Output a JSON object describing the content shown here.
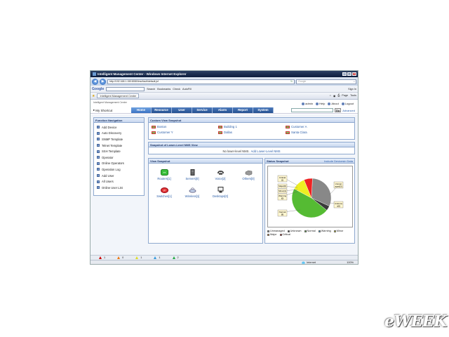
{
  "window": {
    "title": "Intelligent Management Center - Windows Internet Explorer"
  },
  "address": {
    "url": "http://192.168.1.150:8080/imc/fault/default.jsf",
    "search_placeholder": "Google"
  },
  "google_toolbar": {
    "logo": "Google",
    "search_label": "Search",
    "bookmarks": "Bookmarks",
    "check": "Check",
    "autofill": "AutoFill",
    "signin": "Sign In"
  },
  "favbar": {
    "tab_label": "Intelligent Management Center",
    "page": "Page",
    "tools": "Tools"
  },
  "imc": {
    "logo": "Intelligent Management Center",
    "shortcut": "My Shortcut",
    "user_links": {
      "admin": "admin",
      "help": "Help",
      "about": "About",
      "logout": "Logout"
    },
    "go": "Go",
    "advanced": "Advanced",
    "menu": [
      "Home",
      "Resource",
      "User",
      "Service",
      "Alarm",
      "Report",
      "System"
    ]
  },
  "function_nav": {
    "title": "Function Navigation",
    "items": [
      "Add Device",
      "Auto Discovery",
      "SNMP Template",
      "Telnet Template",
      "SSH Template",
      "Operator",
      "Online Operators",
      "Operation Log",
      "Add User",
      "All Users",
      "Online User List"
    ]
  },
  "custom_view": {
    "title": "Custom View Snapshot",
    "items": [
      "Boston",
      "Building 1",
      "Customer A",
      "Customer Y",
      "Dallas",
      "Santa Clara"
    ]
  },
  "lower_nms": {
    "title": "Snapshot of Lower-Level NMS View",
    "message": "No lower-level NMS.",
    "link": "Add Lower-Level NMS"
  },
  "view_snapshot": {
    "title": "View Snapshot",
    "items": [
      {
        "label": "Routers[1]",
        "icon": "router-icon"
      },
      {
        "label": "Servers[0]",
        "icon": "server-icon"
      },
      {
        "label": "Voice[2]",
        "icon": "voice-icon"
      },
      {
        "label": "Others[0]",
        "icon": "others-icon"
      },
      {
        "label": "Switches[1]",
        "icon": "switch-icon"
      },
      {
        "label": "Wireless[1]",
        "icon": "wireless-icon"
      },
      {
        "label": "Desktops[0]",
        "icon": "desktop-icon"
      }
    ]
  },
  "status_snapshot": {
    "title": "Status Snapshot",
    "link": "Include Devicesin Data"
  },
  "chart_data": {
    "type": "pie",
    "title": "",
    "slices": [
      {
        "label": "Unmanaged",
        "value": 31,
        "color": "#888888"
      },
      {
        "label": "Unknown",
        "value": 4,
        "color": "#3a3a3a"
      },
      {
        "label": "Normal",
        "value": 47,
        "color": "#55bb33"
      },
      {
        "label": "Warning",
        "value": 0,
        "color": "#33aadd"
      },
      {
        "label": "Minor",
        "value": 11,
        "color": "#eeee22"
      },
      {
        "label": "Major",
        "value": 0,
        "color": "#ee8822"
      },
      {
        "label": "Critical",
        "value": 7,
        "color": "#ee2222"
      }
    ],
    "callouts": [
      {
        "text": "Critical",
        "sub": "[1]"
      },
      {
        "text": "Major[0]",
        "sub": ""
      },
      {
        "text": "Minor[1]",
        "sub": ""
      },
      {
        "text": "Warning",
        "sub": "[0]"
      },
      {
        "text": "Normal",
        "sub": "[8]"
      },
      {
        "text": "Unman",
        "sub": "aged[3]"
      },
      {
        "text": "Unknow",
        "sub": "n[0]"
      }
    ],
    "legend": [
      "Unmanaged",
      "Unknown",
      "Normal",
      "Warning",
      "Minor",
      "Major",
      "Critical"
    ],
    "legend_placement": "bottom"
  },
  "alarm_bar": {
    "counts": [
      "1",
      "0",
      "1",
      "1",
      "2"
    ],
    "colors": [
      "#cc0000",
      "#ee7711",
      "#dddd22",
      "#3399dd",
      "#22aa44"
    ]
  },
  "statusbar": {
    "zone": "Internet",
    "zoom": "100%"
  },
  "watermark": "eWEEK"
}
